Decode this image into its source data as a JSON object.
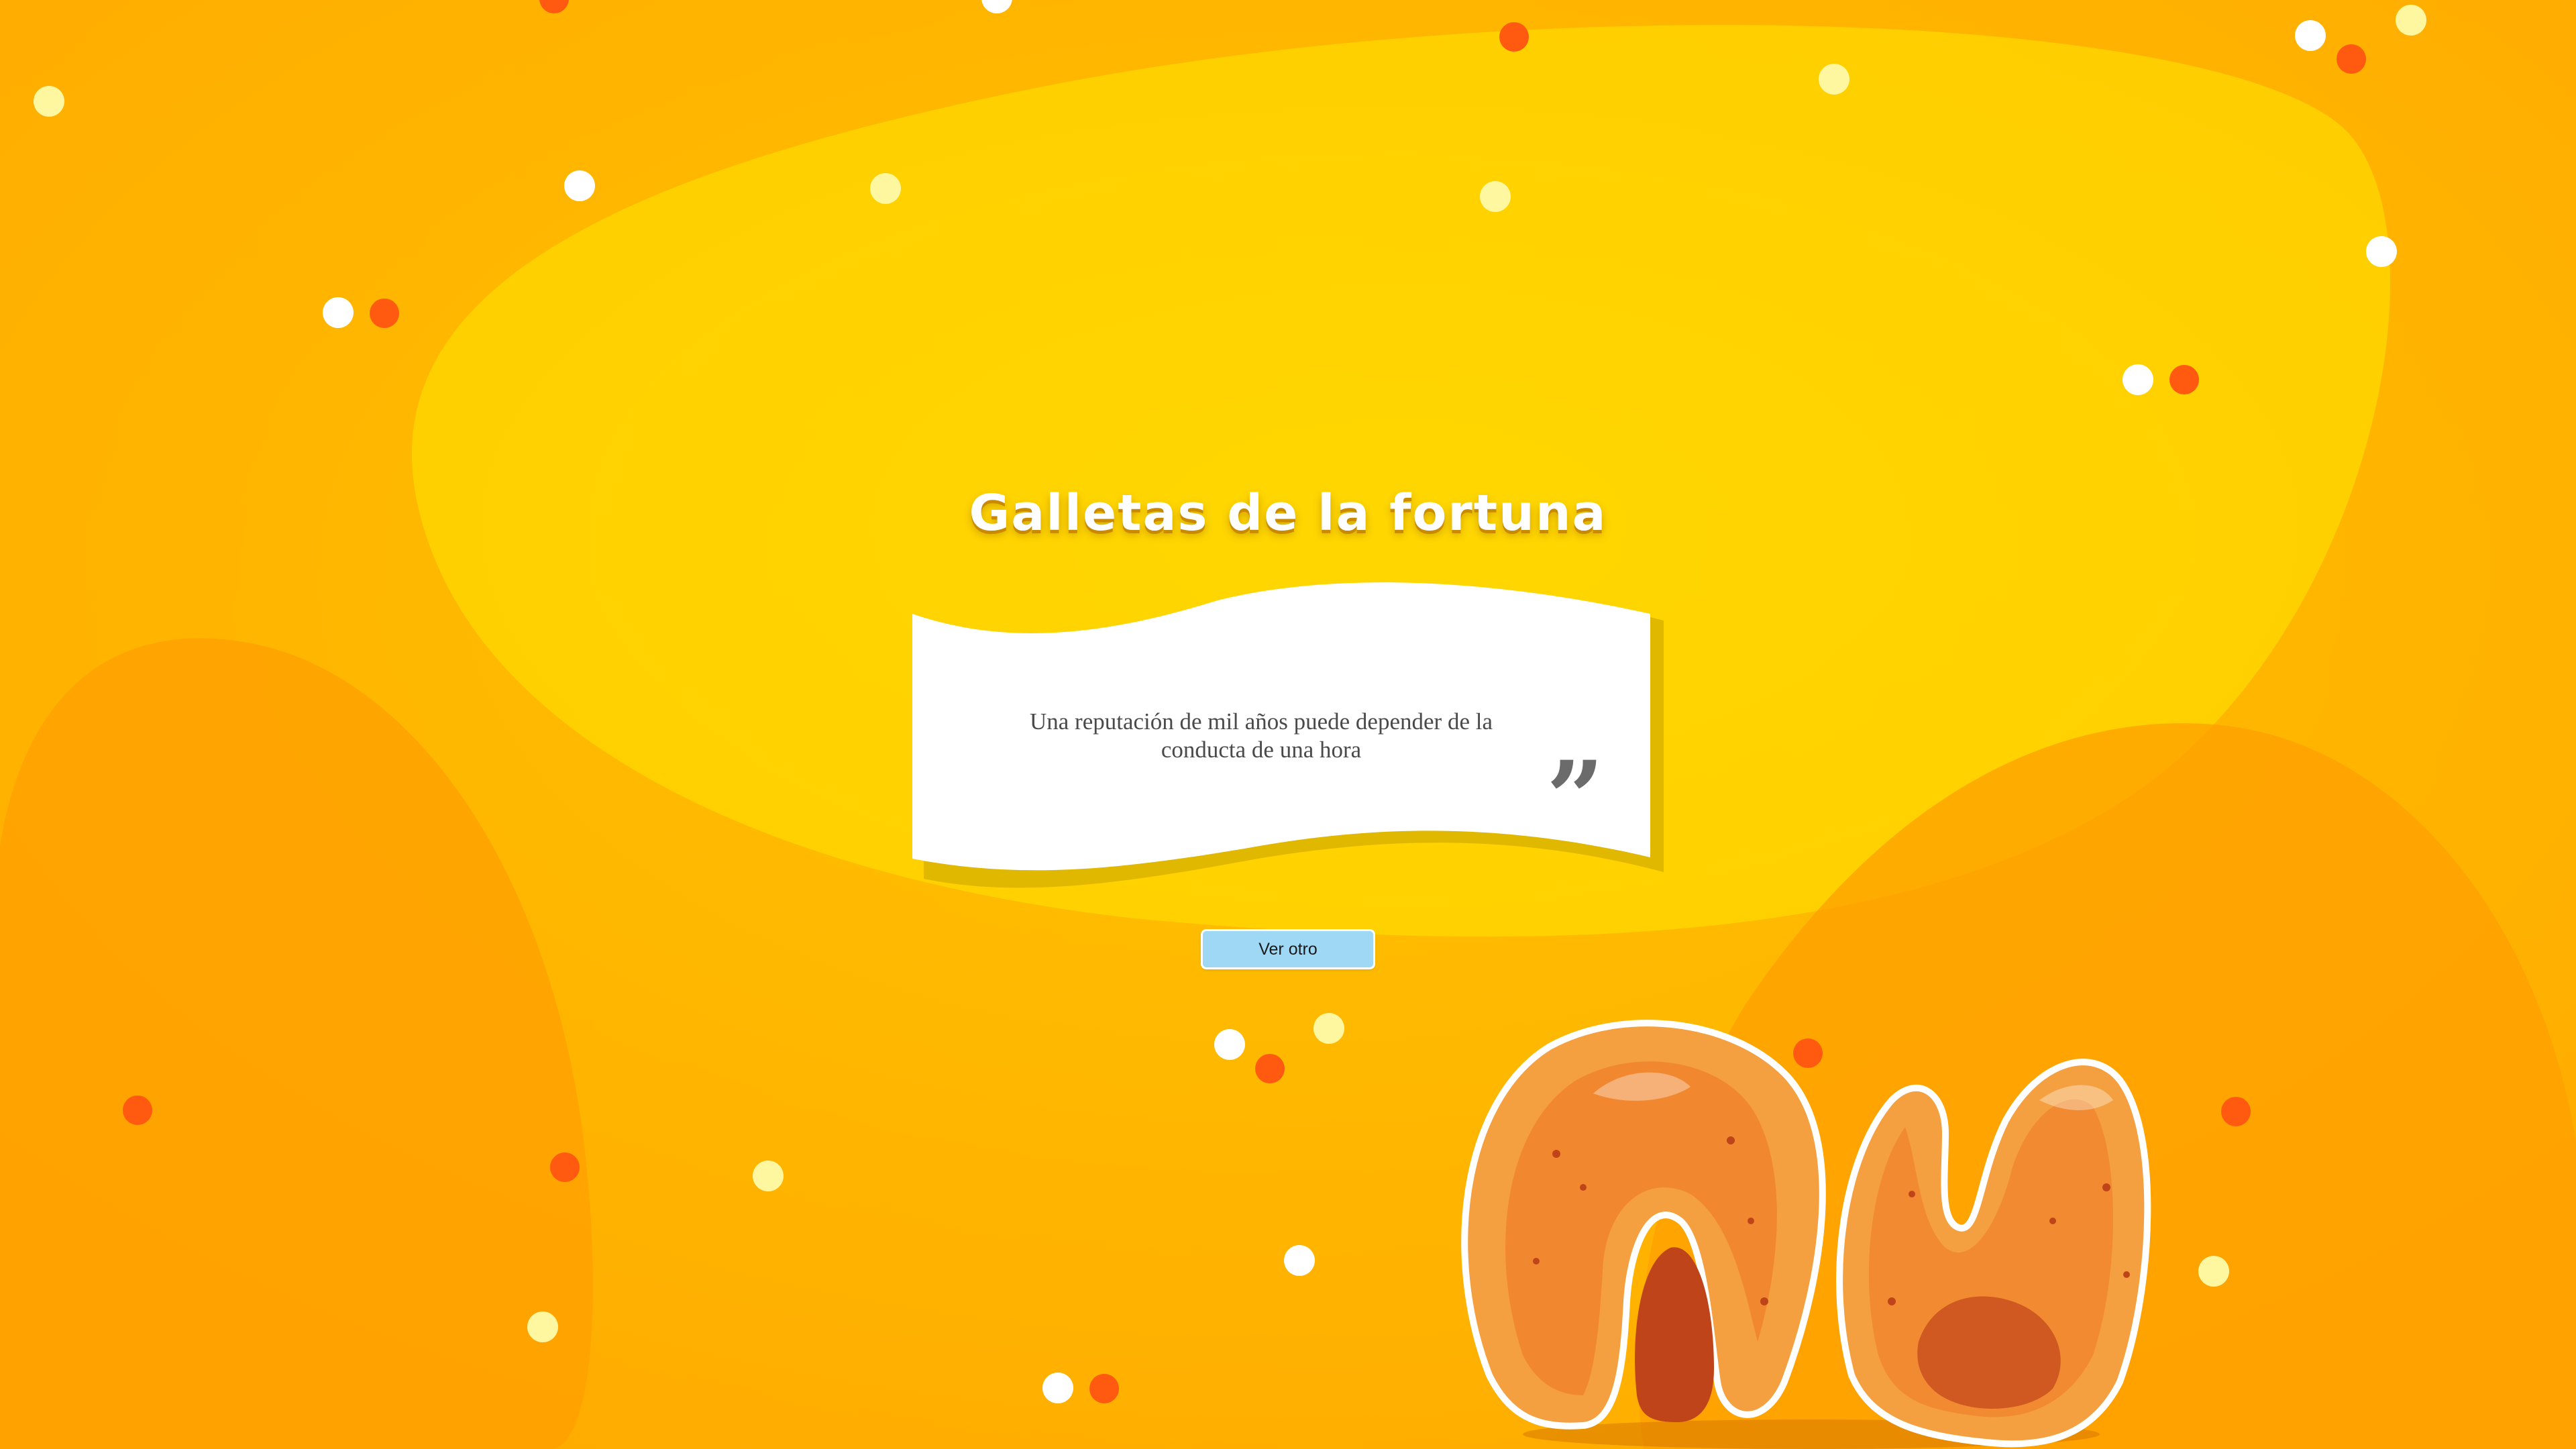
{
  "page": {
    "title": "Galletas de la fortuna",
    "fortune": "Una reputación de mil años puede depender de la conducta de una hora",
    "quote_symbol": "”",
    "next_button_label": "Ver otro"
  },
  "colors": {
    "background": "#ffb000",
    "center_blob": "#ffd400",
    "side_blobs": "#ff9f00",
    "button": "#9fd8f5",
    "white_dot": "#ffffff",
    "cream_dot": "#fff6a0",
    "orange_dot": "#ff5a10"
  },
  "icons": {
    "quote": "closing-quote-icon",
    "illustration": "fortune-cookies-illustration"
  }
}
